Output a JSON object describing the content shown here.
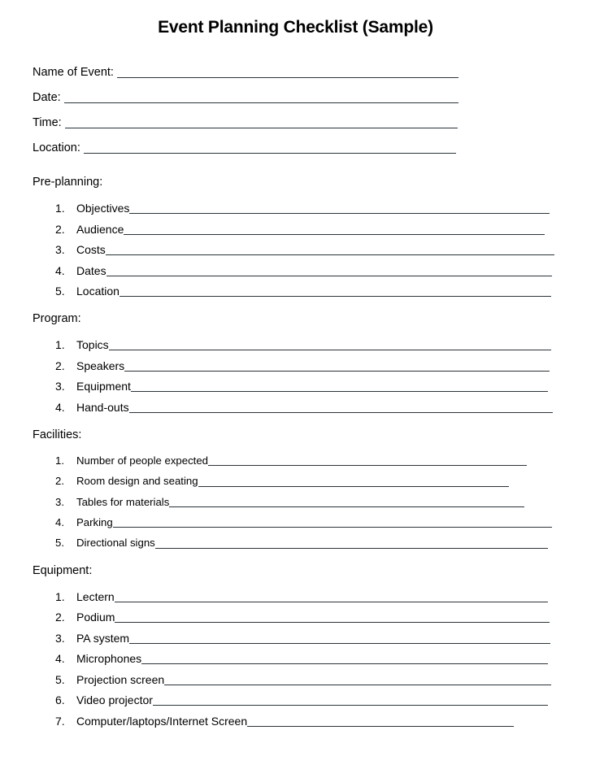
{
  "document": {
    "title": "Event Planning Checklist (Sample)",
    "rule_color": "#2b3338"
  },
  "header_fields": [
    {
      "label": "Name of Event:",
      "value": "",
      "rule_width": 420
    },
    {
      "label": "Date:",
      "value": "",
      "rule_width": 485
    },
    {
      "label": "Time:",
      "value": "",
      "rule_width": 483
    },
    {
      "label": "Location:",
      "value": "",
      "rule_width": 458
    }
  ],
  "sections": [
    {
      "id": "pre-planning",
      "title": "Pre-planning:",
      "items": [
        {
          "num": "1.",
          "label": "Objectives",
          "rule_width": 517
        },
        {
          "num": "2.",
          "label": "Audience",
          "rule_width": 518
        },
        {
          "num": "3.",
          "label": "Costs",
          "rule_width": 552
        },
        {
          "num": "4.",
          "label": "Dates",
          "rule_width": 548
        },
        {
          "num": "5.",
          "label": "Location",
          "rule_width": 531
        }
      ]
    },
    {
      "id": "program",
      "title": "Program:",
      "items": [
        {
          "num": "1.",
          "label": "Topics",
          "rule_width": 544
        },
        {
          "num": "2.",
          "label": "Speakers",
          "rule_width": 523
        },
        {
          "num": "3.",
          "label": "Equipment",
          "rule_width": 513
        },
        {
          "num": "4.",
          "label": "Hand-outs",
          "rule_width": 521
        }
      ]
    },
    {
      "id": "facilities",
      "title": "Facilities:",
      "items": [
        {
          "num": "1.",
          "label": "Number of people expected",
          "rule_width": 392
        },
        {
          "num": "2.",
          "label": "Room design and  seating",
          "rule_width": 382
        },
        {
          "num": "3.",
          "label": "Tables for materials ",
          "rule_width": 437
        },
        {
          "num": "4.",
          "label": "Parking",
          "rule_width": 540
        },
        {
          "num": "5.",
          "label": "Directional signs",
          "rule_width": 483
        }
      ]
    },
    {
      "id": "equipment",
      "title": "Equipment:",
      "items": [
        {
          "num": "1.",
          "label": "Lectern",
          "rule_width": 533
        },
        {
          "num": "2.",
          "label": "Podium",
          "rule_width": 535
        },
        {
          "num": "3.",
          "label": "PA system",
          "rule_width": 518
        },
        {
          "num": "4.",
          "label": "Microphones",
          "rule_width": 500
        },
        {
          "num": "5.",
          "label": "Projection screen",
          "rule_width": 476
        },
        {
          "num": "6.",
          "label": "Video projector",
          "rule_width": 486
        },
        {
          "num": "7.",
          "label": "Computer/laptops/Internet Screen ",
          "rule_width": 328
        }
      ]
    }
  ]
}
